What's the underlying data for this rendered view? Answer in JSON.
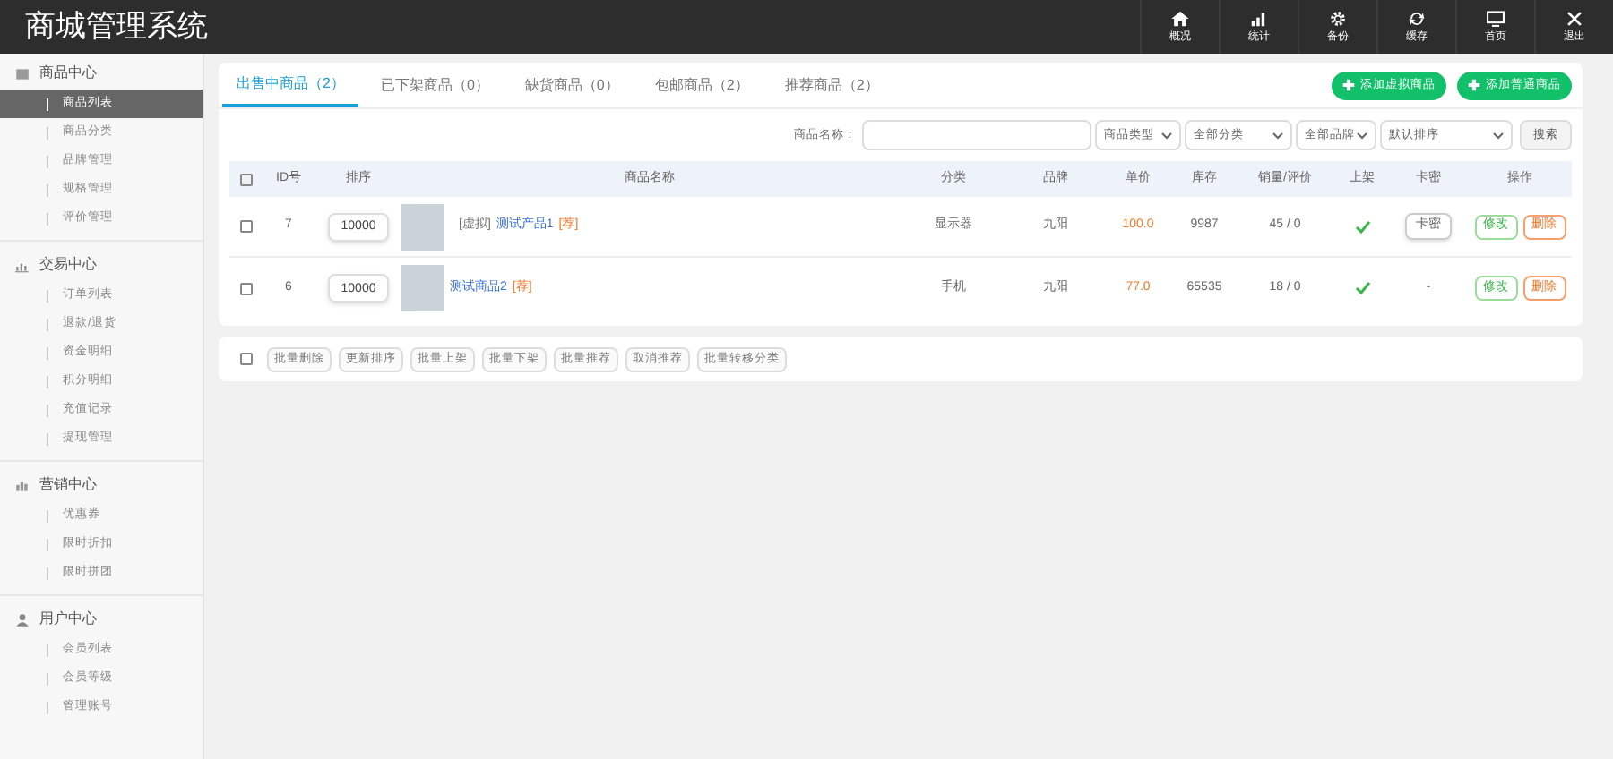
{
  "header": {
    "title": "商城管理系统",
    "nav": [
      {
        "label": "概况"
      },
      {
        "label": "统计"
      },
      {
        "label": "备份"
      },
      {
        "label": "缓存"
      },
      {
        "label": "首页"
      },
      {
        "label": "退出"
      }
    ]
  },
  "sidebar": [
    {
      "title": "商品中心",
      "items": [
        {
          "label": "商品列表",
          "selected": true
        },
        {
          "label": "商品分类",
          "selected": false
        },
        {
          "label": "品牌管理",
          "selected": false
        },
        {
          "label": "规格管理",
          "selected": false
        },
        {
          "label": "评价管理",
          "selected": false
        }
      ]
    },
    {
      "title": "交易中心",
      "items": [
        {
          "label": "订单列表",
          "selected": false
        },
        {
          "label": "退款/退货",
          "selected": false
        },
        {
          "label": "资金明细",
          "selected": false
        },
        {
          "label": "积分明细",
          "selected": false
        },
        {
          "label": "充值记录",
          "selected": false
        },
        {
          "label": "提现管理",
          "selected": false
        }
      ]
    },
    {
      "title": "营销中心",
      "items": [
        {
          "label": "优惠券",
          "selected": false
        },
        {
          "label": "限时折扣",
          "selected": false
        },
        {
          "label": "限时拼团",
          "selected": false
        }
      ]
    },
    {
      "title": "用户中心",
      "items": [
        {
          "label": "会员列表",
          "selected": false
        },
        {
          "label": "会员等级",
          "selected": false
        },
        {
          "label": "管理账号",
          "selected": false
        }
      ]
    }
  ],
  "tabs": [
    {
      "label": "出售中商品（2）",
      "selected": true
    },
    {
      "label": "已下架商品（0）",
      "selected": false
    },
    {
      "label": "缺货商品（0）",
      "selected": false
    },
    {
      "label": "包邮商品（2）",
      "selected": false
    },
    {
      "label": "推荐商品（2）",
      "selected": false
    }
  ],
  "add_buttons": [
    "添加虚拟商品",
    "添加普通商品"
  ],
  "filters": {
    "name_label": "商品名称：",
    "selects": [
      "商品类型",
      "全部分类",
      "全部品牌",
      "默认排序"
    ],
    "search": "搜索"
  },
  "table": {
    "header_checked": false,
    "columns": [
      "ID号",
      "排序",
      "商品名称",
      "分类",
      "品牌",
      "单价",
      "库存",
      "销量/评价",
      "上架",
      "卡密",
      "操作"
    ],
    "rows": [
      {
        "checked": false,
        "id": "7",
        "sort": "10000",
        "prefix": "[虚拟]",
        "name": "测试产品1",
        "tag": "[荐]",
        "category": "显示器",
        "brand": "九阳",
        "price": "100.0",
        "stock": "9987",
        "sales": "45 / 0",
        "listed": true,
        "card": {
          "kind": "button",
          "text": "卡密"
        },
        "edit": "修改",
        "delete": "删除"
      },
      {
        "checked": false,
        "id": "6",
        "sort": "10000",
        "name": "测试商品2",
        "tag": "[荐]",
        "category": "手机",
        "brand": "九阳",
        "price": "77.0",
        "stock": "65535",
        "sales": "18 / 0",
        "listed": true,
        "card": {
          "kind": "text",
          "text": "-"
        },
        "edit": "修改",
        "delete": "删除"
      }
    ]
  },
  "bulk": {
    "checked": false,
    "buttons": [
      "批量删除",
      "更新排序",
      "批量上架",
      "批量下架",
      "批量推荐",
      "取消推荐",
      "批量转移分类"
    ]
  }
}
